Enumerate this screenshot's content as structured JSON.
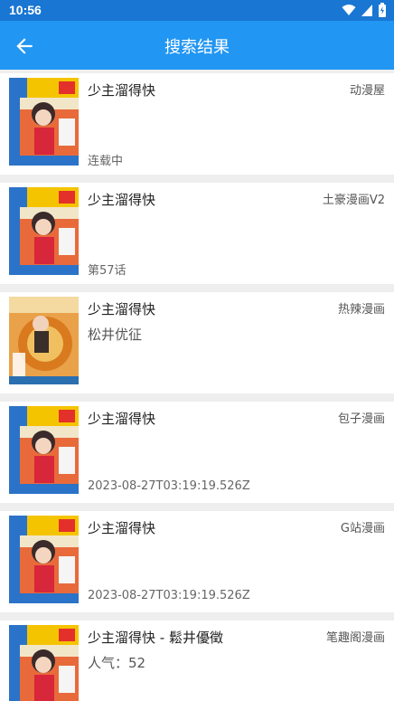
{
  "status_bar": {
    "time": "10:56"
  },
  "app_bar": {
    "title": "搜索结果"
  },
  "results": [
    {
      "name": "少主溜得快",
      "source": "动漫屋",
      "author": "",
      "status": "连载中",
      "cover": "blue-cover"
    },
    {
      "name": "少主溜得快",
      "source": "土豪漫画V2",
      "author": "",
      "status": "第57话",
      "cover": "blue-cover"
    },
    {
      "name": "少主溜得快",
      "source": "热辣漫画",
      "author": "松井优征",
      "status": "",
      "cover": "orange-cover"
    },
    {
      "name": "少主溜得快",
      "source": "包子漫画",
      "author": "",
      "status": "2023-08-27T03:19:19.526Z",
      "cover": "blue-cover"
    },
    {
      "name": "少主溜得快",
      "source": "G站漫画",
      "author": "",
      "status": "2023-08-27T03:19:19.526Z",
      "cover": "blue-cover"
    },
    {
      "name": "少主溜得快 - 鬆井優徵",
      "source": "笔趣阁漫画",
      "author": "人气：52",
      "status": "",
      "cover": "blue-cover"
    }
  ]
}
